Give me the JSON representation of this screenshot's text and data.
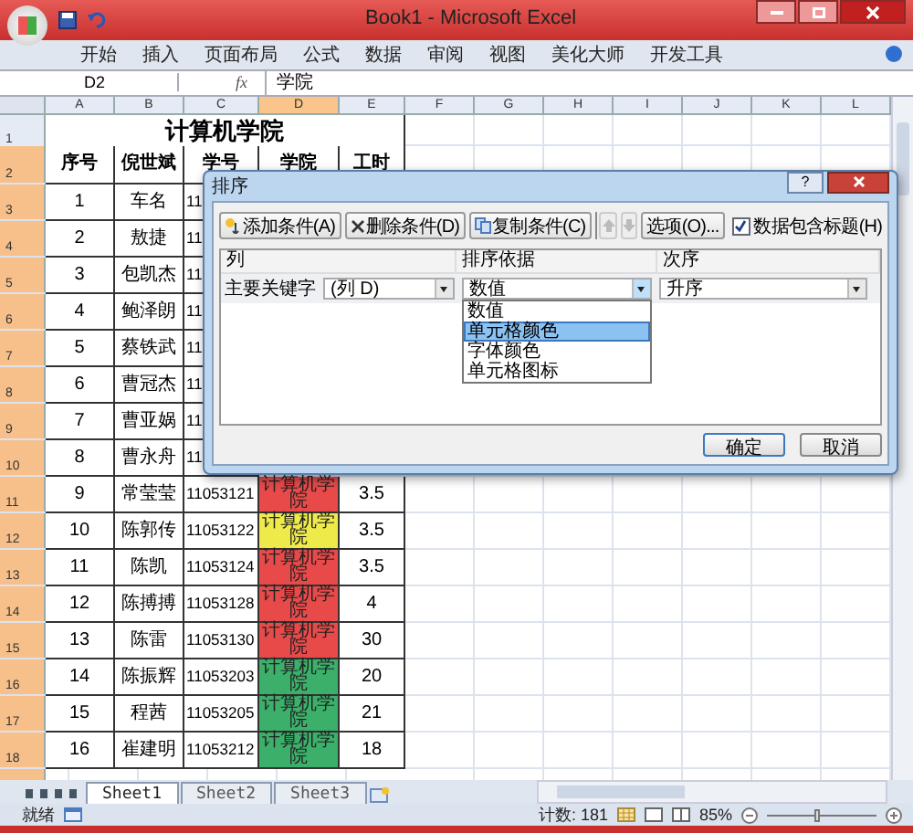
{
  "window": {
    "title": "Book1 - Microsoft Excel"
  },
  "ribbon_tabs": [
    "开始",
    "插入",
    "页面布局",
    "公式",
    "数据",
    "审阅",
    "视图",
    "美化大师",
    "开发工具"
  ],
  "name_box": "D2",
  "fx_label": "fx",
  "formula": "学院",
  "columns": [
    {
      "label": "A",
      "selected": false
    },
    {
      "label": "B",
      "selected": false
    },
    {
      "label": "C",
      "selected": false
    },
    {
      "label": "D",
      "selected": true
    },
    {
      "label": "E",
      "selected": false
    },
    {
      "label": "F",
      "selected": false
    },
    {
      "label": "G",
      "selected": false
    },
    {
      "label": "H",
      "selected": false
    },
    {
      "label": "I",
      "selected": false
    },
    {
      "label": "J",
      "selected": false
    },
    {
      "label": "K",
      "selected": false
    },
    {
      "label": "L",
      "selected": false
    }
  ],
  "title_row": {
    "number": "1",
    "selected": false,
    "text": "计算机学院"
  },
  "rows": [
    {
      "number": "2",
      "selected": true,
      "kind": "header",
      "cells": [
        "序号",
        "倪世斌",
        "学号",
        "学院",
        "工时"
      ]
    },
    {
      "number": "3",
      "selected": true,
      "kind": "data",
      "cells": [
        "1",
        "车名",
        "11"
      ]
    },
    {
      "number": "4",
      "selected": true,
      "kind": "data",
      "cells": [
        "2",
        "敖捷",
        "11"
      ]
    },
    {
      "number": "5",
      "selected": true,
      "kind": "data",
      "cells": [
        "3",
        "包凯杰",
        "11"
      ]
    },
    {
      "number": "6",
      "selected": true,
      "kind": "data",
      "cells": [
        "4",
        "鲍泽朗",
        "11"
      ]
    },
    {
      "number": "7",
      "selected": true,
      "kind": "data",
      "cells": [
        "5",
        "蔡铁武",
        "11"
      ]
    },
    {
      "number": "8",
      "selected": true,
      "kind": "data",
      "cells": [
        "6",
        "曹冠杰",
        "11"
      ]
    },
    {
      "number": "9",
      "selected": true,
      "kind": "data",
      "cells": [
        "7",
        "曹亚娲",
        "11"
      ]
    },
    {
      "number": "10",
      "selected": true,
      "kind": "data",
      "cells": [
        "8",
        "曹永舟",
        "11"
      ]
    },
    {
      "number": "11",
      "selected": true,
      "kind": "data",
      "color": "#e84a4a",
      "cells": [
        "9",
        "常莹莹",
        "11053121",
        "计算机学院",
        "3.5"
      ]
    },
    {
      "number": "12",
      "selected": true,
      "kind": "data",
      "color": "#eeea4a",
      "cells": [
        "10",
        "陈郭传",
        "11053122",
        "计算机学院",
        "3.5"
      ]
    },
    {
      "number": "13",
      "selected": true,
      "kind": "data",
      "color": "#e84a4a",
      "cells": [
        "11",
        "陈凯",
        "11053124",
        "计算机学院",
        "3.5"
      ]
    },
    {
      "number": "14",
      "selected": true,
      "kind": "data",
      "color": "#e84a4a",
      "cells": [
        "12",
        "陈搏搏",
        "11053128",
        "计算机学院",
        "4"
      ]
    },
    {
      "number": "15",
      "selected": true,
      "kind": "data",
      "color": "#e84a4a",
      "cells": [
        "13",
        "陈雷",
        "11053130",
        "计算机学院",
        "30"
      ]
    },
    {
      "number": "16",
      "selected": true,
      "kind": "data",
      "color": "#3cb06a",
      "cells": [
        "14",
        "陈振辉",
        "11053203",
        "计算机学院",
        "20"
      ]
    },
    {
      "number": "17",
      "selected": true,
      "kind": "data",
      "color": "#3cb06a",
      "cells": [
        "15",
        "程茜",
        "11053205",
        "计算机学院",
        "21"
      ]
    },
    {
      "number": "18",
      "selected": true,
      "kind": "data",
      "color": "#3cb06a",
      "cells": [
        "16",
        "崔建明",
        "11053212",
        "计算机学院",
        "18"
      ]
    }
  ],
  "sort_dialog": {
    "title": "排序",
    "help_label": "?",
    "buttons": [
      {
        "label": "添加条件(A)",
        "kind": "add"
      },
      {
        "label": "删除条件(D)",
        "kind": "delete"
      },
      {
        "label": "复制条件(C)",
        "kind": "copy"
      }
    ],
    "move_buttons": [
      {
        "kind": "up",
        "disabled": true
      },
      {
        "kind": "down",
        "disabled": true
      }
    ],
    "options_button": "选项(O)...",
    "header_checkbox": {
      "label": "数据包含标题(H)",
      "checked": true
    },
    "columns": [
      "列",
      "排序依据",
      "次序"
    ],
    "level": {
      "label": "主要关键字",
      "column": "(列 D)",
      "sort_on": "数值",
      "order": "升序"
    },
    "sort_on_options": [
      {
        "label": "数值",
        "selected": false
      },
      {
        "label": "单元格颜色",
        "selected": true
      },
      {
        "label": "字体颜色",
        "selected": false
      },
      {
        "label": "单元格图标",
        "selected": false
      }
    ],
    "ok": "确定",
    "cancel": "取消"
  },
  "sheet_tabs": [
    {
      "label": "Sheet1",
      "selected": true
    },
    {
      "label": "Sheet2",
      "selected": false
    },
    {
      "label": "Sheet3",
      "selected": false
    }
  ],
  "status_bar": {
    "ready": "就绪",
    "count": "计数: 181",
    "zoom": "85%",
    "zoom_slider": {
      "level": 0.45
    }
  }
}
